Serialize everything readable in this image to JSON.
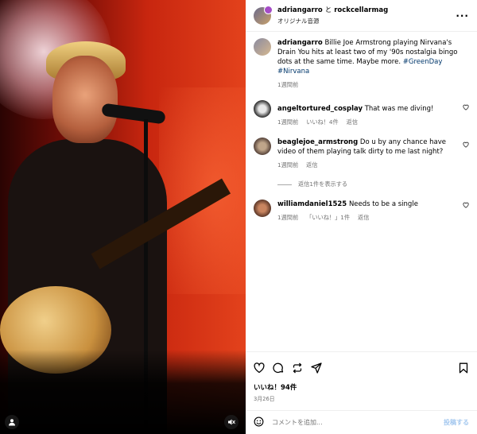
{
  "header": {
    "user1": "adriangarro",
    "connector": "と",
    "user2": "rockcellarmag",
    "audio": "オリジナル音源",
    "more": "···"
  },
  "caption": {
    "username": "adriangarro",
    "text": "Billie Joe Armstrong playing Nirvana's Drain You hits at least two of my '90s nostalgia bingo dots at the same time. Maybe more.",
    "tags": "#GreenDay #Nirvana",
    "time": "1週間前"
  },
  "comments": [
    {
      "username": "angeltortured_cosplay",
      "text": "That was me diving!",
      "time": "1週間前",
      "likes": "いいね！4件",
      "reply": "返信"
    },
    {
      "username": "beaglejoe_armstrong",
      "text": "Do u by any chance have video of them playing talk dirty to me last night?",
      "time": "1週間前",
      "reply": "返信"
    },
    {
      "username": "williamdaniel1525",
      "text": "Needs to be a single",
      "time": "1週間前",
      "likes": "「いいね！」1件",
      "reply": "返信"
    }
  ],
  "view_replies": "返信1件を表示する",
  "likes": "いいね！94件",
  "date": "3月26日",
  "composer": {
    "placeholder": "コメントを追加...",
    "post": "投稿する"
  },
  "icons": {
    "heart": "heart-icon",
    "comment": "comment-icon",
    "repost": "repost-icon",
    "share": "share-icon",
    "save": "bookmark-icon",
    "emoji": "emoji-icon",
    "user": "user-tag-icon",
    "mute": "mute-icon"
  },
  "colors": {
    "link": "#00376b",
    "muted": "#737373",
    "post_disabled": "#a4c8ef"
  }
}
